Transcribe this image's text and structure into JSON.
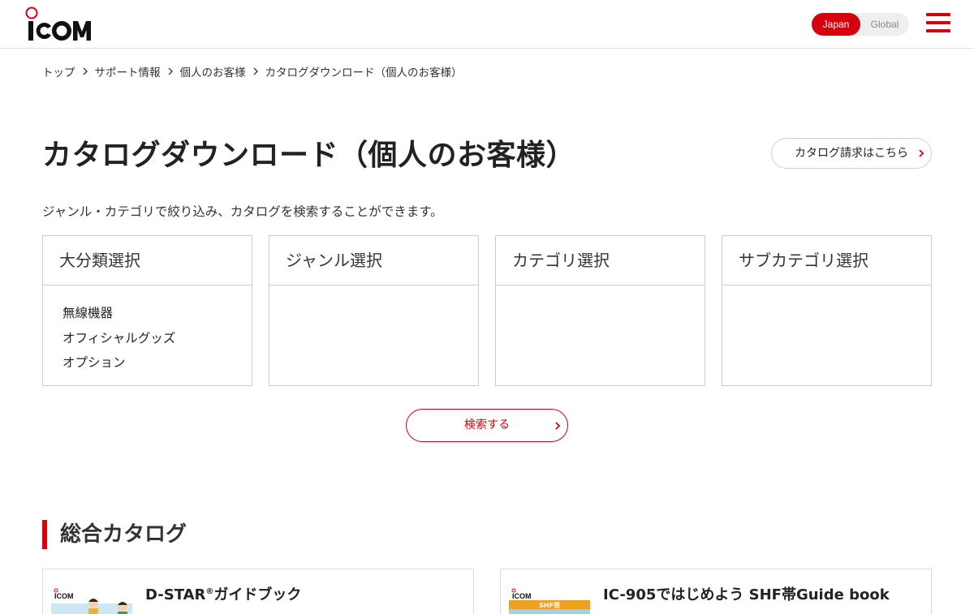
{
  "header": {
    "logo_text": "ICOM",
    "languages": [
      {
        "label": "Japan",
        "active": true
      },
      {
        "label": "Global",
        "active": false
      }
    ],
    "brand_color": "#d7000f"
  },
  "breadcrumb": [
    "トップ",
    "サポート情報",
    "個人のお客様",
    "カタログダウンロード（個人のお客様）"
  ],
  "page": {
    "title": "カタログダウンロード（個人のお客様）",
    "request_link": "カタログ請求はこちら",
    "lead": "ジャンル・カテゴリで絞り込み、カタログを検索することができます。"
  },
  "panels": [
    {
      "title": "大分類選択",
      "items": [
        "無線機器",
        "オフィシャルグッズ",
        "オプション"
      ]
    },
    {
      "title": "ジャンル選択",
      "items": []
    },
    {
      "title": "カテゴリ選択",
      "items": []
    },
    {
      "title": "サブカテゴリ選択",
      "items": []
    }
  ],
  "search_button": "検索する",
  "section": {
    "title": "総合カタログ",
    "cards": [
      {
        "title": "D-STAR",
        "title_sup": "®",
        "title_suffix": "ガイドブック",
        "thumb_logo": "ICOM"
      },
      {
        "title": "IC-905ではじめよう SHF帯Guide book",
        "thumb_logo": "ICOM",
        "thumb_text": "SHF帯"
      }
    ]
  }
}
